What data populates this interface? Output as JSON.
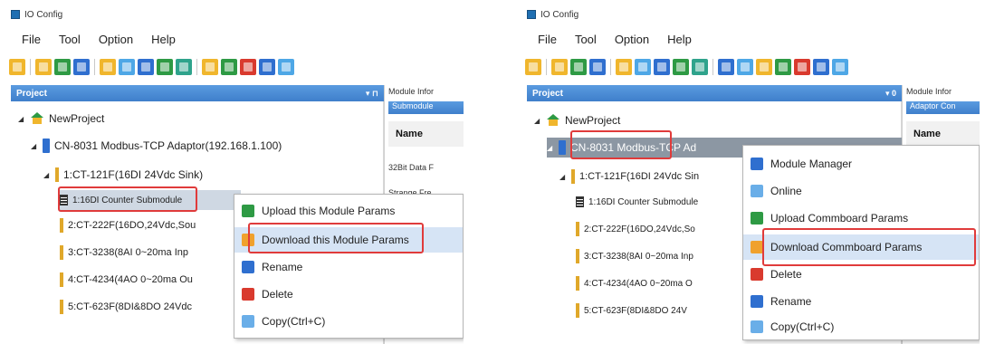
{
  "left": {
    "window_title": "IO Config",
    "menu": [
      "File",
      "Tool",
      "Option",
      "Help"
    ],
    "project_header": "Project",
    "pin_glyph": "▾ ⊓",
    "tree": {
      "root": "NewProject",
      "adaptor": "CN-8031 Modbus-TCP Adaptor(192.168.1.100)",
      "modules": [
        "1:CT-121F(16DI 24Vdc Sink)",
        "1:16DI Counter Submodule",
        "2:CT-222F(16DO,24Vdc,Sou",
        "3:CT-3238(8AI 0~20ma Inp",
        "4:CT-4234(4AO 0~20ma Ou",
        "5:CT-623F(8DI&8DO 24Vdc"
      ]
    },
    "module_info": {
      "title": "Module Infor",
      "tab": "Submodule",
      "column": "Name",
      "rows": [
        "32Bit Data F",
        "Strange Fre"
      ]
    },
    "context_menu": [
      "Upload this Module Params",
      "Download this Module Params",
      "Rename",
      "Delete",
      "Copy(Ctrl+C)"
    ]
  },
  "right": {
    "window_title": "IO Config",
    "menu": [
      "File",
      "Tool",
      "Option",
      "Help"
    ],
    "project_header": "Project",
    "pin_glyph": "▾ 0",
    "tree": {
      "root": "NewProject",
      "adaptor": "CN-8031 Modbus-TCP Ad",
      "modules": [
        "1:CT-121F(16DI 24Vdc Sin",
        "1:16DI Counter Submodule",
        "2:CT-222F(16DO,24Vdc,So",
        "3:CT-3238(8AI 0~20ma Inp",
        "4:CT-4234(4AO 0~20ma O",
        "5:CT-623F(8DI&8DO 24V"
      ]
    },
    "module_info": {
      "title": "Module Infor",
      "tab": "Adaptor Con",
      "column": "Name",
      "rows": []
    },
    "context_menu": [
      "Module Manager",
      "Online",
      "Upload Commboard Params",
      "Download Commboard Params",
      "Delete",
      "Rename",
      "Copy(Ctrl+C)"
    ]
  }
}
